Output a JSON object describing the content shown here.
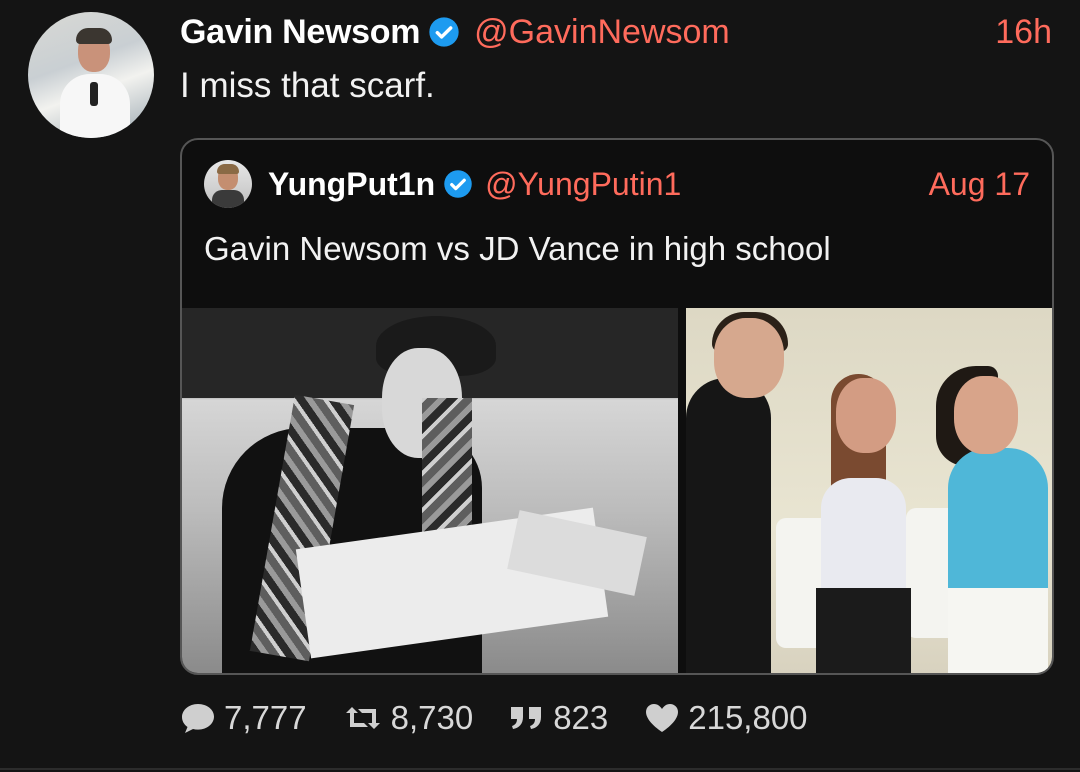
{
  "tweet": {
    "author_name": "Gavin Newsom",
    "author_handle": "@GavinNewsom",
    "time": "16h",
    "text": "I miss that scarf."
  },
  "quoted_tweet": {
    "author_name": "YungPut1n",
    "author_handle": "@YungPutin1",
    "time": "Aug 17",
    "text": "Gavin Newsom vs JD Vance in high school"
  },
  "actions": {
    "replies": "7,777",
    "retweets": "8,730",
    "quotes": "823",
    "likes": "215,800"
  },
  "colors": {
    "background": "#141414",
    "accent": "#ff6b5c",
    "verified": "#1d9bf0",
    "text": "#f2f2f2"
  },
  "icons": [
    "verified-badge-icon",
    "reply-icon",
    "retweet-icon",
    "quote-icon",
    "like-icon"
  ]
}
